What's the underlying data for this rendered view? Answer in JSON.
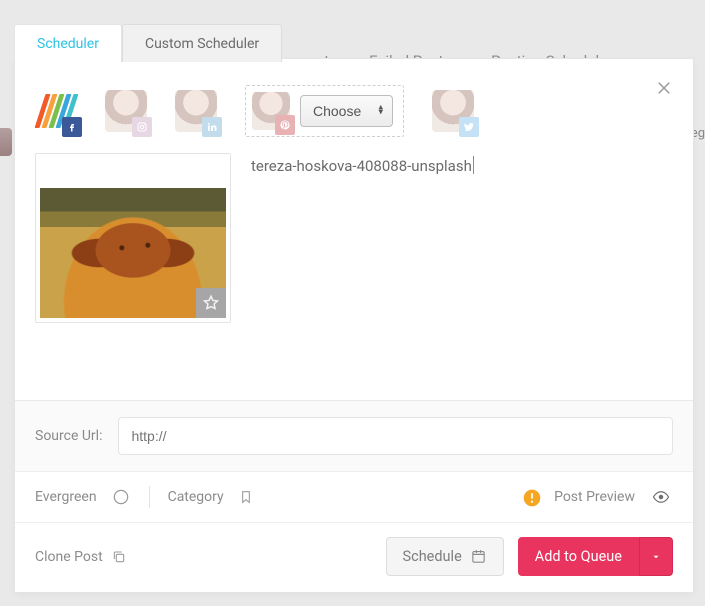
{
  "tabs": {
    "scheduler": "Scheduler",
    "custom": "Custom Scheduler"
  },
  "bg_nav": {
    "item1": "ent",
    "item2": "Failed Posts",
    "item3": "Posting Schedule",
    "right": "eg"
  },
  "accounts": {
    "select_placeholder": "Choose"
  },
  "caption": "tereza-hoskova-408088-unsplash",
  "form": {
    "source_label": "Source Url:",
    "source_placeholder": "http://"
  },
  "options": {
    "evergreen": "Evergreen",
    "category": "Category",
    "preview": "Post Preview"
  },
  "footer": {
    "clone": "Clone Post",
    "schedule": "Schedule",
    "queue": "Add to Queue"
  }
}
